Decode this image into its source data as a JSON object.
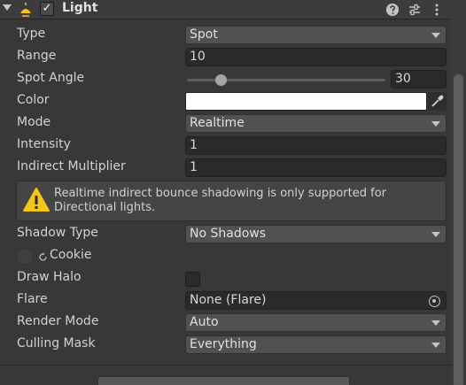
{
  "component": {
    "title": "Light",
    "enabled_glyph": "✓",
    "header_icons": [
      "help-icon",
      "preset-icon",
      "more-icon"
    ]
  },
  "fields": {
    "type": {
      "label": "Type",
      "value": "Spot"
    },
    "range": {
      "label": "Range",
      "value": "10"
    },
    "spot_angle": {
      "label": "Spot Angle",
      "value": "30",
      "slider_fraction": 0.17
    },
    "color": {
      "label": "Color",
      "value": "#ffffff"
    },
    "mode": {
      "label": "Mode",
      "value": "Realtime"
    },
    "intensity": {
      "label": "Intensity",
      "value": "1"
    },
    "indirect_multiplier": {
      "label": "Indirect Multiplier",
      "value": "1"
    },
    "shadow_type": {
      "label": "Shadow Type",
      "value": "No Shadows"
    },
    "cookie": {
      "label": "Cookie"
    },
    "draw_halo": {
      "label": "Draw Halo",
      "checked": false
    },
    "flare": {
      "label": "Flare",
      "value": "None (Flare)"
    },
    "render_mode": {
      "label": "Render Mode",
      "value": "Auto"
    },
    "culling_mask": {
      "label": "Culling Mask",
      "value": "Everything"
    }
  },
  "warning": {
    "text": "Realtime indirect bounce shadowing is only supported for Directional lights.",
    "icon": "warning-icon"
  },
  "colors": {
    "panel_bg": "#383838",
    "field_bg": "#2a2a2a",
    "dropdown_bg": "#515151",
    "warning_yellow": "#f5c518"
  }
}
